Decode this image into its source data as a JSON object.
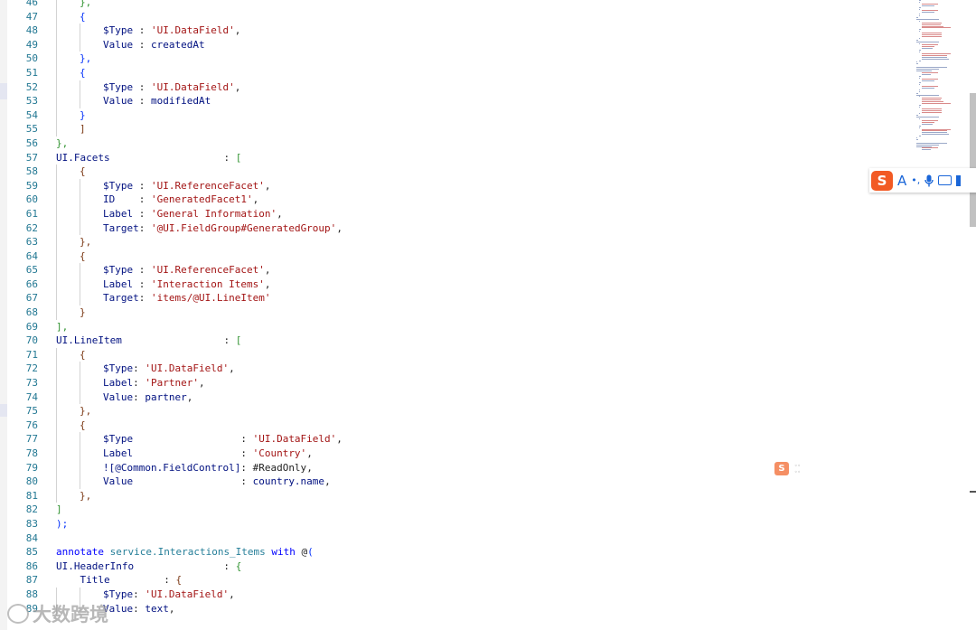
{
  "editor": {
    "lines": [
      {
        "n": "46",
        "indent": 1,
        "tokens": [
          {
            "t": "},",
            "c": "t-b2"
          }
        ]
      },
      {
        "n": "47",
        "indent": 1,
        "tokens": [
          {
            "t": "{",
            "c": "t-b1"
          }
        ]
      },
      {
        "n": "48",
        "indent": 2,
        "tokens": [
          {
            "t": "$Type",
            "c": "t-ann"
          },
          {
            "t": " : ",
            "c": "t-p"
          },
          {
            "t": "'UI.DataField'",
            "c": "t-str"
          },
          {
            "t": ",",
            "c": "t-p"
          }
        ]
      },
      {
        "n": "49",
        "indent": 2,
        "tokens": [
          {
            "t": "Value",
            "c": "t-ann"
          },
          {
            "t": " : ",
            "c": "t-p"
          },
          {
            "t": "createdAt",
            "c": "t-ann"
          }
        ]
      },
      {
        "n": "50",
        "indent": 1,
        "tokens": [
          {
            "t": "},",
            "c": "t-b1"
          }
        ]
      },
      {
        "n": "51",
        "indent": 1,
        "tokens": [
          {
            "t": "{",
            "c": "t-b1"
          }
        ]
      },
      {
        "n": "52",
        "indent": 2,
        "tokens": [
          {
            "t": "$Type",
            "c": "t-ann"
          },
          {
            "t": " : ",
            "c": "t-p"
          },
          {
            "t": "'UI.DataField'",
            "c": "t-str"
          },
          {
            "t": ",",
            "c": "t-p"
          }
        ]
      },
      {
        "n": "53",
        "indent": 2,
        "tokens": [
          {
            "t": "Value",
            "c": "t-ann"
          },
          {
            "t": " : ",
            "c": "t-p"
          },
          {
            "t": "modifiedAt",
            "c": "t-ann"
          }
        ]
      },
      {
        "n": "54",
        "indent": 1,
        "tokens": [
          {
            "t": "}",
            "c": "t-b1"
          }
        ]
      },
      {
        "n": "55",
        "indent": 1,
        "tokens": [
          {
            "t": "]",
            "c": "t-b3"
          }
        ]
      },
      {
        "n": "56",
        "indent": 0,
        "tokens": [
          {
            "t": "},",
            "c": "t-b2"
          }
        ]
      },
      {
        "n": "57",
        "indent": 0,
        "tokens": [
          {
            "t": "UI.Facets",
            "c": "t-ann"
          },
          {
            "t": "                   : ",
            "c": "t-p"
          },
          {
            "t": "[",
            "c": "t-b2"
          }
        ]
      },
      {
        "n": "58",
        "indent": 1,
        "tokens": [
          {
            "t": "{",
            "c": "t-b3"
          }
        ]
      },
      {
        "n": "59",
        "indent": 2,
        "tokens": [
          {
            "t": "$Type",
            "c": "t-ann"
          },
          {
            "t": " : ",
            "c": "t-p"
          },
          {
            "t": "'UI.ReferenceFacet'",
            "c": "t-str"
          },
          {
            "t": ",",
            "c": "t-p"
          }
        ]
      },
      {
        "n": "60",
        "indent": 2,
        "tokens": [
          {
            "t": "ID",
            "c": "t-ann"
          },
          {
            "t": "    : ",
            "c": "t-p"
          },
          {
            "t": "'GeneratedFacet1'",
            "c": "t-str"
          },
          {
            "t": ",",
            "c": "t-p"
          }
        ]
      },
      {
        "n": "61",
        "indent": 2,
        "tokens": [
          {
            "t": "Label",
            "c": "t-ann"
          },
          {
            "t": " : ",
            "c": "t-p"
          },
          {
            "t": "'General Information'",
            "c": "t-str"
          },
          {
            "t": ",",
            "c": "t-p"
          }
        ]
      },
      {
        "n": "62",
        "indent": 2,
        "tokens": [
          {
            "t": "Target",
            "c": "t-ann"
          },
          {
            "t": ": ",
            "c": "t-p"
          },
          {
            "t": "'@UI.FieldGroup#GeneratedGroup'",
            "c": "t-str"
          },
          {
            "t": ",",
            "c": "t-p"
          }
        ]
      },
      {
        "n": "63",
        "indent": 1,
        "tokens": [
          {
            "t": "},",
            "c": "t-b3"
          }
        ]
      },
      {
        "n": "64",
        "indent": 1,
        "tokens": [
          {
            "t": "{",
            "c": "t-b3"
          }
        ]
      },
      {
        "n": "65",
        "indent": 2,
        "tokens": [
          {
            "t": "$Type",
            "c": "t-ann"
          },
          {
            "t": " : ",
            "c": "t-p"
          },
          {
            "t": "'UI.ReferenceFacet'",
            "c": "t-str"
          },
          {
            "t": ",",
            "c": "t-p"
          }
        ]
      },
      {
        "n": "66",
        "indent": 2,
        "tokens": [
          {
            "t": "Label",
            "c": "t-ann"
          },
          {
            "t": " : ",
            "c": "t-p"
          },
          {
            "t": "'Interaction Items'",
            "c": "t-str"
          },
          {
            "t": ",",
            "c": "t-p"
          }
        ]
      },
      {
        "n": "67",
        "indent": 2,
        "tokens": [
          {
            "t": "Target",
            "c": "t-ann"
          },
          {
            "t": ": ",
            "c": "t-p"
          },
          {
            "t": "'items/@UI.LineItem'",
            "c": "t-str"
          }
        ]
      },
      {
        "n": "68",
        "indent": 1,
        "tokens": [
          {
            "t": "}",
            "c": "t-b3"
          }
        ]
      },
      {
        "n": "69",
        "indent": 0,
        "tokens": [
          {
            "t": "],",
            "c": "t-b2"
          }
        ]
      },
      {
        "n": "70",
        "indent": 0,
        "tokens": [
          {
            "t": "UI.LineItem",
            "c": "t-ann"
          },
          {
            "t": "                 : ",
            "c": "t-p"
          },
          {
            "t": "[",
            "c": "t-b2"
          }
        ]
      },
      {
        "n": "71",
        "indent": 1,
        "tokens": [
          {
            "t": "{",
            "c": "t-b3"
          }
        ]
      },
      {
        "n": "72",
        "indent": 2,
        "tokens": [
          {
            "t": "$Type",
            "c": "t-ann"
          },
          {
            "t": ": ",
            "c": "t-p"
          },
          {
            "t": "'UI.DataField'",
            "c": "t-str"
          },
          {
            "t": ",",
            "c": "t-p"
          }
        ]
      },
      {
        "n": "73",
        "indent": 2,
        "tokens": [
          {
            "t": "Label",
            "c": "t-ann"
          },
          {
            "t": ": ",
            "c": "t-p"
          },
          {
            "t": "'Partner'",
            "c": "t-str"
          },
          {
            "t": ",",
            "c": "t-p"
          }
        ]
      },
      {
        "n": "74",
        "indent": 2,
        "tokens": [
          {
            "t": "Value",
            "c": "t-ann"
          },
          {
            "t": ": ",
            "c": "t-p"
          },
          {
            "t": "partner",
            "c": "t-ann"
          },
          {
            "t": ",",
            "c": "t-p"
          }
        ]
      },
      {
        "n": "75",
        "indent": 1,
        "tokens": [
          {
            "t": "},",
            "c": "t-b3"
          }
        ]
      },
      {
        "n": "76",
        "indent": 1,
        "tokens": [
          {
            "t": "{",
            "c": "t-b3"
          }
        ]
      },
      {
        "n": "77",
        "indent": 2,
        "tokens": [
          {
            "t": "$Type",
            "c": "t-ann"
          },
          {
            "t": "                  : ",
            "c": "t-p"
          },
          {
            "t": "'UI.DataField'",
            "c": "t-str"
          },
          {
            "t": ",",
            "c": "t-p"
          }
        ]
      },
      {
        "n": "78",
        "indent": 2,
        "tokens": [
          {
            "t": "Label",
            "c": "t-ann"
          },
          {
            "t": "                  : ",
            "c": "t-p"
          },
          {
            "t": "'Country'",
            "c": "t-str"
          },
          {
            "t": ",",
            "c": "t-p"
          }
        ]
      },
      {
        "n": "79",
        "indent": 2,
        "tokens": [
          {
            "t": "![@Common.FieldControl]",
            "c": "t-ann"
          },
          {
            "t": ": ",
            "c": "t-p"
          },
          {
            "t": "#ReadOnly",
            "c": "t-p"
          },
          {
            "t": ",",
            "c": "t-p"
          }
        ]
      },
      {
        "n": "80",
        "indent": 2,
        "tokens": [
          {
            "t": "Value",
            "c": "t-ann"
          },
          {
            "t": "                  : ",
            "c": "t-p"
          },
          {
            "t": "country.name",
            "c": "t-ann"
          },
          {
            "t": ",",
            "c": "t-p"
          }
        ]
      },
      {
        "n": "81",
        "indent": 1,
        "tokens": [
          {
            "t": "},",
            "c": "t-b3"
          }
        ]
      },
      {
        "n": "82",
        "indent": 0,
        "tokens": [
          {
            "t": "]",
            "c": "t-b2"
          }
        ]
      },
      {
        "n": "83",
        "indent": 0,
        "tokens": [
          {
            "t": ");",
            "c": "t-b1"
          }
        ]
      },
      {
        "n": "84",
        "indent": 0,
        "tokens": []
      },
      {
        "n": "85",
        "indent": 0,
        "tokens": [
          {
            "t": "annotate",
            "c": "t-kw"
          },
          {
            "t": " ",
            "c": "t-p"
          },
          {
            "t": "service.Interactions_Items",
            "c": "t-id"
          },
          {
            "t": " ",
            "c": "t-p"
          },
          {
            "t": "with",
            "c": "t-kw"
          },
          {
            "t": " @",
            "c": "t-p"
          },
          {
            "t": "(",
            "c": "t-b1"
          }
        ]
      },
      {
        "n": "86",
        "indent": 0,
        "tokens": [
          {
            "t": "UI.HeaderInfo",
            "c": "t-ann"
          },
          {
            "t": "               : ",
            "c": "t-p"
          },
          {
            "t": "{",
            "c": "t-b2"
          }
        ]
      },
      {
        "n": "87",
        "indent": 0,
        "tokens": [
          {
            "t": "    Title",
            "c": "t-ann"
          },
          {
            "t": "         : ",
            "c": "t-p"
          },
          {
            "t": "{",
            "c": "t-b3"
          }
        ]
      },
      {
        "n": "88",
        "indent": 2,
        "tokens": [
          {
            "t": "$Type",
            "c": "t-ann"
          },
          {
            "t": ": ",
            "c": "t-p"
          },
          {
            "t": "'UI.DataField'",
            "c": "t-str"
          },
          {
            "t": ",",
            "c": "t-p"
          }
        ]
      },
      {
        "n": "89",
        "indent": 2,
        "tokens": [
          {
            "t": "Value",
            "c": "t-ann"
          },
          {
            "t": ": ",
            "c": "t-p"
          },
          {
            "t": "text",
            "c": "t-ann"
          },
          {
            "t": ",",
            "c": "t-p"
          }
        ]
      }
    ]
  },
  "ime_toolbar": {
    "logo_label": "S",
    "mode_label": "A",
    "punct_label": "•,",
    "icons": [
      "mic-icon",
      "keyboard-icon",
      "more-icon"
    ]
  },
  "floating_ime": {
    "logo_label": "S"
  },
  "watermark": {
    "text": "大数跨境"
  }
}
